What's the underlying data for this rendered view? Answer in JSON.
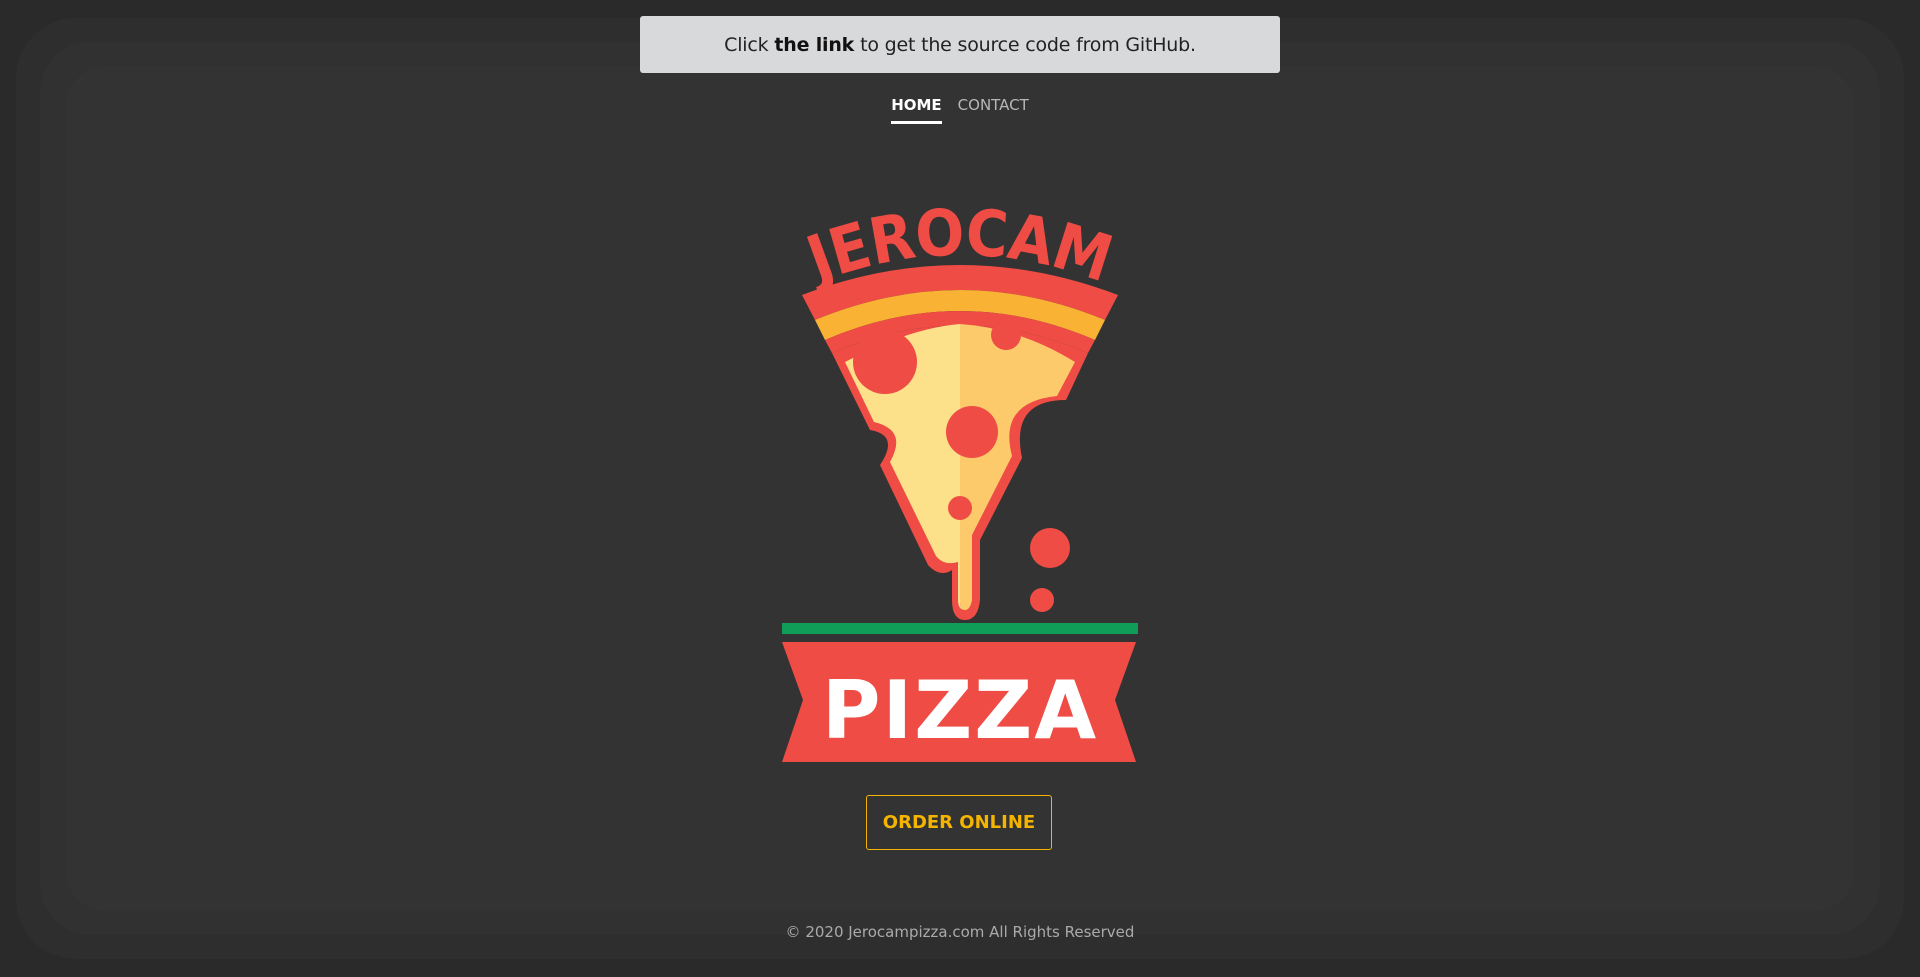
{
  "banner": {
    "prefix": "Click",
    "link": "the link",
    "suffix": "to get the source code from GitHub."
  },
  "nav": {
    "items": [
      {
        "label": "HOME"
      },
      {
        "label": "CONTACT"
      }
    ]
  },
  "logo": {
    "top_text": "JEROCAM",
    "bottom_text": "PIZZA"
  },
  "hero": {
    "order_button": "ORDER ONLINE"
  },
  "footer": {
    "text": "© 2020 Jerocampizza.com All Rights Reserved"
  },
  "colors": {
    "accent": "#f4b400",
    "brand_red": "#ef4c45",
    "cheese": "#fde08a",
    "crust": "#f9b234",
    "green": "#0f9d58"
  }
}
